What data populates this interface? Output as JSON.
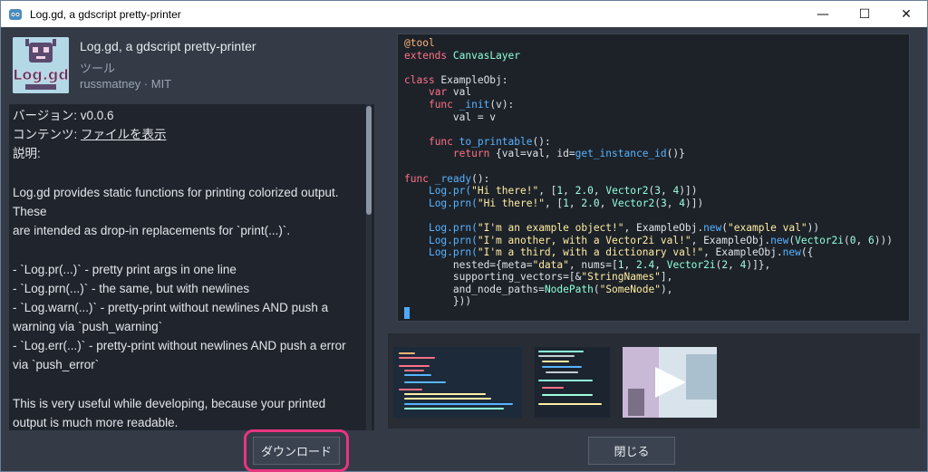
{
  "window": {
    "title": "Log.gd, a gdscript pretty-printer",
    "controls": [
      "—",
      "☐",
      "✕"
    ]
  },
  "header": {
    "title": "Log.gd, a gdscript pretty-printer",
    "category": "ツール",
    "meta": "russmatney · MIT",
    "logo_text": "Log.gd"
  },
  "description": {
    "version_line": "バージョン: v0.0.6",
    "content_label": "コンテンツ: ",
    "content_link": "ファイルを表示",
    "desc_label": "説明:",
    "lines": [
      "",
      "Log.gd provides static functions for printing colorized output.",
      "These",
      "are intended as drop-in replacements for `print(...)`.",
      "",
      "- `Log.pr(...)` - pretty print args in one line",
      "- `Log.prn(...)` - the same, but with newlines",
      "- `Log.warn(...)` - pretty-print without newlines AND push a",
      "warning via `push_warning`",
      "- `Log.err(...)` - pretty-print without newlines AND push a error",
      "via `push_error`",
      "",
      "This is very useful while developing, because your printed",
      "output is much more readable."
    ]
  },
  "code": {
    "l1": "@tool",
    "l2a": "extends",
    "l2b": "CanvasLayer",
    "l4a": "class",
    "l4b": " ExampleObj:",
    "l5a": "var",
    "l5b": " val",
    "l6a": "func",
    "l6b": "_init",
    "l6c": "(v):",
    "l7": "val = v",
    "l9a": "func",
    "l9b": "to_printable",
    "l9c": "():",
    "l10a": "return",
    "l10b": " {val=val, id=",
    "l10c": "get_instance_id",
    "l10d": "()}",
    "l12a": "func",
    "l12b": "_ready",
    "l12c": "():",
    "l13a": "Log.pr(",
    "l13b": "\"Hi there!\"",
    "l13c": ", [",
    "l13d": "1",
    "l13e": ", ",
    "l13f": "2.0",
    "l13g": ", ",
    "l13h": "Vector2",
    "l13i": "(",
    "l13j": "3",
    "l13k": ", ",
    "l13l": "4",
    "l13m": ")])",
    "l14a": "Log.prn(",
    "l14b": "\"Hi there!\"",
    "l14c": ", [",
    "l14d": "1",
    "l14e": ", ",
    "l14f": "2.0",
    "l14g": ", ",
    "l14h": "Vector2",
    "l14i": "(",
    "l14j": "3",
    "l14k": ", ",
    "l14l": "4",
    "l14m": ")])",
    "l16a": "Log.prn(",
    "l16b": "\"I'm an example object!\"",
    "l16c": ", ExampleObj.",
    "l16d": "new",
    "l16e": "(",
    "l16f": "\"example val\"",
    "l16g": "))",
    "l17a": "Log.prn(",
    "l17b": "\"I'm another, with a Vector2i val!\"",
    "l17c": ", ExampleObj.",
    "l17d": "new",
    "l17e": "(",
    "l17f": "Vector2i",
    "l17g": "(",
    "l17h": "0",
    "l17i": ", ",
    "l17j": "6",
    "l17k": ")))",
    "l18a": "Log.prn(",
    "l18b": "\"I'm a third, with a dictionary val!\"",
    "l18c": ", ExampleObj.",
    "l18d": "new",
    "l18e": "({",
    "l19a": "nested={meta=",
    "l19b": "\"data\"",
    "l19c": ", nums=[",
    "l19d": "1",
    "l19e": ", ",
    "l19f": "2.4",
    "l19g": ", ",
    "l19h": "Vector2i",
    "l19i": "(",
    "l19j": "2",
    "l19k": ", ",
    "l19l": "4",
    "l19m": ")]},",
    "l20a": "supporting_vectors=[&",
    "l20b": "\"StringNames\"",
    "l20c": "],",
    "l21a": "and_node_paths=",
    "l21b": "NodePath",
    "l21c": "(",
    "l21d": "\"SomeNode\"",
    "l21e": "),",
    "l22": "}))"
  },
  "buttons": {
    "download": "ダウンロード",
    "close": "閉じる"
  },
  "colors": {
    "highlight": "#e8357f",
    "keyword": "#ff7085",
    "function": "#57b3ff",
    "type": "#8effda",
    "string": "#ffeda1"
  }
}
